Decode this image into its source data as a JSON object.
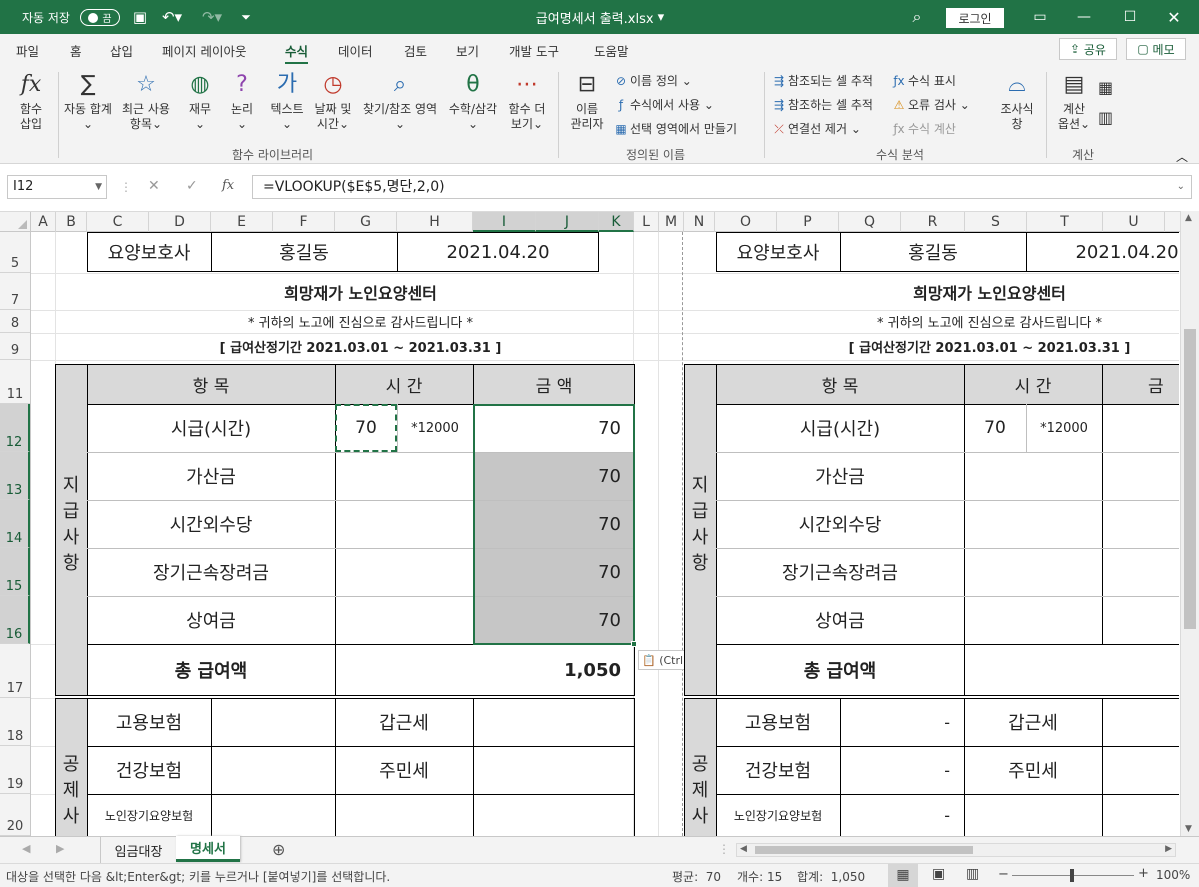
{
  "titlebar": {
    "autosave": "자동 저장",
    "toggle": "끔",
    "filename": "급여명세서 출력.xlsx",
    "login": "로그인"
  },
  "tabs": [
    "파일",
    "홈",
    "삽입",
    "페이지 레이아웃",
    "수식",
    "데이터",
    "검토",
    "보기",
    "개발 도구",
    "도움말"
  ],
  "share": "공유",
  "memo": "메모",
  "ribbon": {
    "fx": [
      "함수",
      "삽입"
    ],
    "autosum": [
      "자동 합계"
    ],
    "recent": [
      "최근 사용",
      "항목"
    ],
    "finance": [
      "재무"
    ],
    "logic": [
      "논리"
    ],
    "text": [
      "텍스트"
    ],
    "date": [
      "날짜 및",
      "시간"
    ],
    "lookup": [
      "찾기/참조 영역"
    ],
    "math": [
      "수학/삼각"
    ],
    "more": [
      "함수 더",
      "보기"
    ],
    "names": [
      "이름",
      "관리자"
    ],
    "define": "이름 정의",
    "useform": "수식에서 사용",
    "create": "선택 영역에서 만들기",
    "trace_pre": "참조되는 셀 추적",
    "trace_dep": "참조하는 셀 추적",
    "remove_arrows": "연결선 제거",
    "show_form": "수식 표시",
    "err_check": "오류 검사",
    "eval": "수식 계산",
    "watch": [
      "조사식",
      "창"
    ],
    "calc": [
      "계산",
      "옵션"
    ],
    "groups": {
      "lib": "함수 라이브러리",
      "defined": "정의된 이름",
      "audit": "수식 분석",
      "calc": "계산"
    }
  },
  "namebox": "I12",
  "formula": "=VLOOKUP($E$5,명단,2,0)",
  "columns": [
    "A",
    "B",
    "C",
    "D",
    "E",
    "F",
    "G",
    "H",
    "I",
    "J",
    "K",
    "L",
    "M",
    "N",
    "O",
    "P",
    "Q",
    "R",
    "S",
    "T",
    "U"
  ],
  "rows": [
    "5",
    "7",
    "8",
    "9",
    "11",
    "12",
    "13",
    "14",
    "15",
    "16",
    "17",
    "18",
    "19",
    "20"
  ],
  "left": {
    "role": "요양보호사",
    "name": "홍길동",
    "date": "2021.04.20",
    "company": "희망재가 노인요양센터",
    "thanks": "* 귀하의 노고에 진심으로 감사드립니다 *",
    "period": "[ 급여산정기간 2021.03.01 ~ 2021.03.31 ]",
    "h_item": "항 목",
    "h_time": "시 간",
    "h_amount": "금 액",
    "pay_label": "지급사항",
    "pay_rows": [
      {
        "item": "시급(시간)",
        "time": "70",
        "rate": "*12000",
        "amount": "70"
      },
      {
        "item": "가산금",
        "amount": "70"
      },
      {
        "item": "시간외수당",
        "amount": "70"
      },
      {
        "item": "장기근속장려금",
        "amount": "70"
      },
      {
        "item": "상여금",
        "amount": "70"
      }
    ],
    "total_label": "총 급여액",
    "total": "1,050",
    "ded_label": "공제사",
    "ded": [
      {
        "a": "고용보험",
        "b": "갑근세"
      },
      {
        "a": "건강보험",
        "b": "주민세"
      },
      {
        "a": "노인장기요양보험",
        "b": ""
      }
    ]
  },
  "right": {
    "role": "요양보호사",
    "name": "홍길동",
    "date": "2021.04.20",
    "company": "희망재가 노인요양센터",
    "thanks": "* 귀하의 노고에 진심으로 감사드립니다 *",
    "period": "[ 급여산정기간 2021.03.01 ~ 2021.03.31 ]",
    "h_item": "항 목",
    "h_time": "시 간",
    "h_amount": "금",
    "pay_label": "지급사항",
    "pay_items": [
      "시급(시간)",
      "가산금",
      "시간외수당",
      "장기근속장려금",
      "상여금"
    ],
    "time": "70",
    "rate": "*12000",
    "total_label": "총 급여액",
    "ded": [
      {
        "a": "고용보험",
        "v": "-",
        "b": "갑근세"
      },
      {
        "a": "건강보험",
        "v": "-",
        "b": "주민세"
      },
      {
        "a": "노인장기요양보험",
        "v": "-",
        "b": ""
      }
    ],
    "ded_label": "공제사"
  },
  "paste": "(Ctrl)",
  "sheets": [
    "임금대장",
    "명세서"
  ],
  "status": {
    "msg": "대상을 선택한 다음 &lt;Enter&gt; 키를 누르거나 [붙여넣기]를 선택합니다.",
    "avg_label": "평균:",
    "avg": "70",
    "count_label": "개수:",
    "count": "15",
    "sum_label": "합계:",
    "sum": "1,050",
    "zoom": "100%"
  },
  "colors": {
    "accent": "#217346",
    "selection": "#c6c6c6",
    "header_fill": "#d9d9d9"
  }
}
